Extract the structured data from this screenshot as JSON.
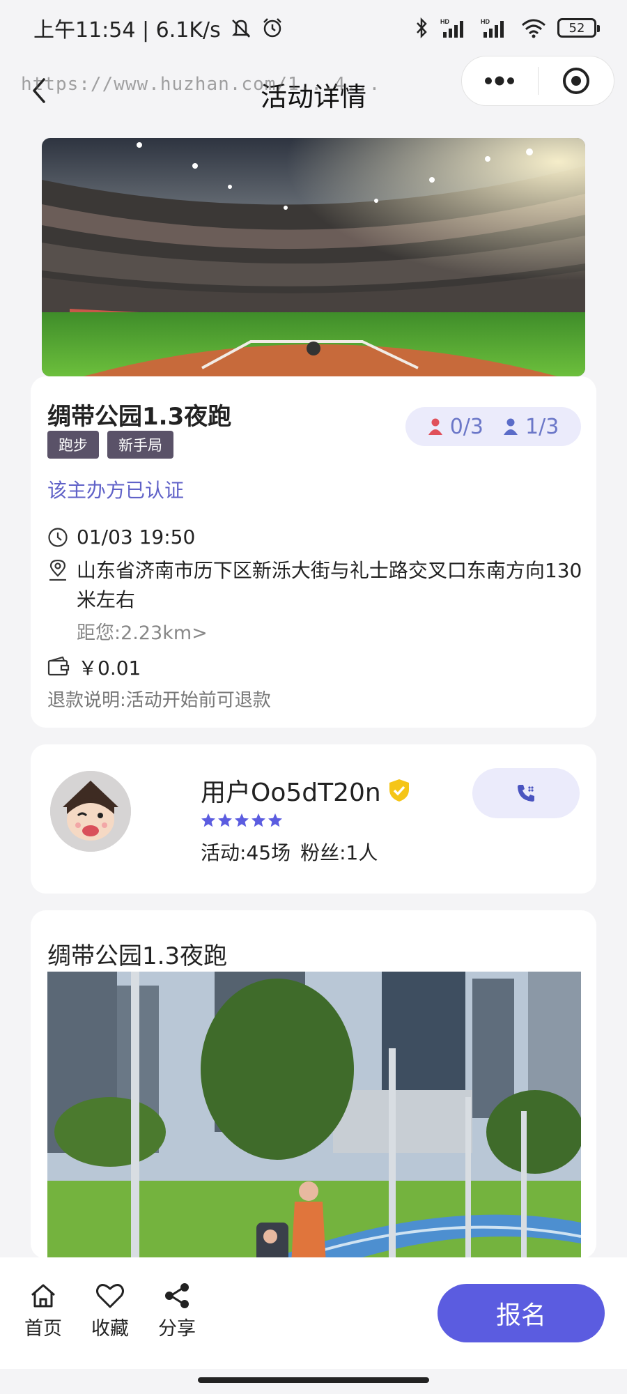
{
  "status_bar": {
    "time_speed": "上午11:54 | 6.1K/s",
    "battery": "52"
  },
  "nav": {
    "title": "活动详情",
    "watermark": "https://www.huzhan.com/1...4..."
  },
  "event": {
    "title": "绸带公园1.3夜跑",
    "tags": [
      "跑步",
      "新手局"
    ],
    "female_count": "0/3",
    "male_count": "1/3",
    "verified_text": "该主办方已认证",
    "time": "01/03 19:50",
    "address": "山东省济南市历下区新泺大街与礼士路交叉口东南方向130米左右",
    "distance": "距您:2.23km>",
    "price": "￥0.01",
    "refund_note": "退款说明:活动开始前可退款"
  },
  "host": {
    "name": "用户Oo5dT20n",
    "rating": 5,
    "activities": "活动:45场",
    "fans": "粉丝:1人"
  },
  "description": {
    "title": "绸带公园1.3夜跑"
  },
  "bottom_bar": {
    "home_label": "首页",
    "favorite_label": "收藏",
    "share_label": "分享",
    "signup_label": "报名"
  },
  "colors": {
    "accent": "#5b5ce0",
    "tag_bg": "#5a5268",
    "pill_bg": "#ebebfb",
    "verified": "#6062c8",
    "star": "#5b5ce0",
    "badge": "#f5c518"
  },
  "icons": [
    "back-icon",
    "more-icon",
    "target-icon",
    "clock-icon",
    "location-icon",
    "wallet-icon",
    "female-icon",
    "male-icon",
    "verified-badge-icon",
    "star-icon",
    "phone-icon",
    "home-icon",
    "heart-icon",
    "share-icon"
  ]
}
